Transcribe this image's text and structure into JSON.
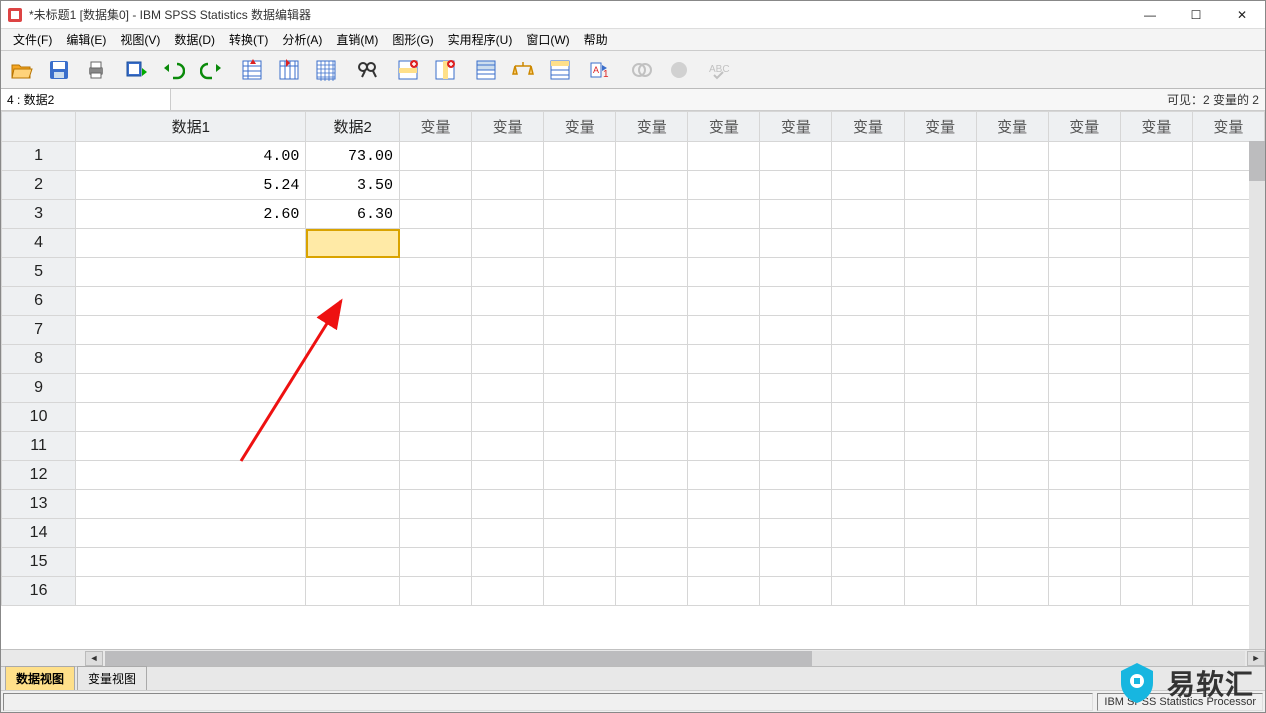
{
  "window": {
    "title": "*未标题1 [数据集0] - IBM SPSS Statistics 数据编辑器",
    "minimize": "—",
    "maximize": "☐",
    "close": "✕"
  },
  "menu": {
    "file": "文件(F)",
    "edit": "编辑(E)",
    "view": "视图(V)",
    "data": "数据(D)",
    "transform": "转换(T)",
    "analyze": "分析(A)",
    "direct": "直销(M)",
    "graphics": "图形(G)",
    "utility": "实用程序(U)",
    "window": "窗口(W)",
    "help": "帮助"
  },
  "toolbar": {
    "icons": [
      "open",
      "save",
      "print",
      "",
      "recall-dialog",
      "undo",
      "redo",
      "",
      "goto-case",
      "goto-var",
      "variables",
      "",
      "find",
      "",
      "insert-case",
      "insert-var",
      "",
      "split-file",
      "weight-cases",
      "select-cases",
      "",
      "value-labels",
      "",
      "use-sets",
      "show-all",
      "",
      "spellcheck"
    ]
  },
  "cellref": {
    "name": "4 : 数据2",
    "visible": "可见：2 变量的 2"
  },
  "columns": [
    "数据1",
    "数据2",
    "变量",
    "变量",
    "变量",
    "变量",
    "变量",
    "变量",
    "变量",
    "变量",
    "变量",
    "变量",
    "变量",
    "变量"
  ],
  "rows": [
    {
      "n": "1",
      "cells": [
        "4.00",
        "73.00"
      ]
    },
    {
      "n": "2",
      "cells": [
        "5.24",
        "3.50"
      ]
    },
    {
      "n": "3",
      "cells": [
        "2.60",
        "6.30"
      ]
    },
    {
      "n": "4",
      "cells": [
        "",
        ""
      ]
    },
    {
      "n": "5",
      "cells": [
        "",
        ""
      ]
    },
    {
      "n": "6",
      "cells": [
        "",
        ""
      ]
    },
    {
      "n": "7",
      "cells": [
        "",
        ""
      ]
    },
    {
      "n": "8",
      "cells": [
        "",
        ""
      ]
    },
    {
      "n": "9",
      "cells": [
        "",
        ""
      ]
    },
    {
      "n": "10",
      "cells": [
        "",
        ""
      ]
    },
    {
      "n": "11",
      "cells": [
        "",
        ""
      ]
    },
    {
      "n": "12",
      "cells": [
        "",
        ""
      ]
    },
    {
      "n": "13",
      "cells": [
        "",
        ""
      ]
    },
    {
      "n": "14",
      "cells": [
        "",
        ""
      ]
    },
    {
      "n": "15",
      "cells": [
        "",
        ""
      ]
    },
    {
      "n": "16",
      "cells": [
        "",
        ""
      ]
    }
  ],
  "selected": {
    "row": 3,
    "col": 1
  },
  "tabs": {
    "data_view": "数据视图",
    "var_view": "变量视图"
  },
  "status": {
    "processor": "IBM SPSS Statistics Processor"
  },
  "watermark": {
    "text": "易软汇"
  }
}
